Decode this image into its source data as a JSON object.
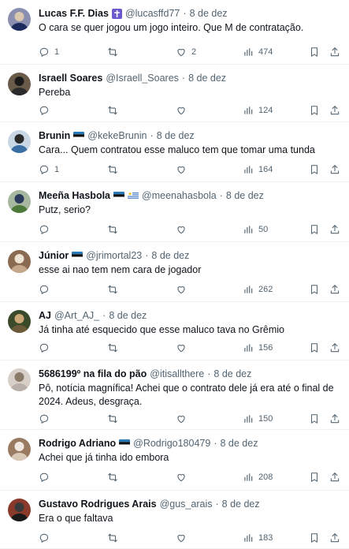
{
  "tweets": [
    {
      "name": "Lucas F.F. Dias",
      "handle": "@lucasffd77",
      "date": "8 de dez",
      "text": "O cara se quer jogou um jogo inteiro. Que M de contratação.",
      "replies": "1",
      "retweets": "",
      "likes": "2",
      "views": "474",
      "badge": "cross-badge-icon",
      "avatar_colors": [
        "#1c2a5e",
        "#8a8fb0",
        "#d9c7b0"
      ]
    },
    {
      "name": "Israell Soares",
      "handle": "@Israell_Soares",
      "date": "8 de dez",
      "text": "Pereba",
      "replies": "",
      "retweets": "",
      "likes": "",
      "views": "124",
      "avatar_colors": [
        "#2b2b2b",
        "#6a5a4a",
        "#1a1a1a"
      ]
    },
    {
      "name": "Brunin",
      "handle": "@kekeBrunin",
      "date": "8 de dez",
      "text": "Cara... Quem contratou esse maluco tem que tomar uma tunda",
      "replies": "1",
      "retweets": "",
      "likes": "",
      "views": "164",
      "flags": [
        "flag-gremio"
      ],
      "avatar_colors": [
        "#3a6ea5",
        "#c9d6e3",
        "#2a2a2a"
      ]
    },
    {
      "name": "Meeña Hasbola",
      "handle": "@meenahasbola",
      "date": "8 de dez",
      "text": "Putz, serio?",
      "replies": "",
      "retweets": "",
      "likes": "",
      "views": "50",
      "flags": [
        "flag-gremio",
        "flag-uruguay"
      ],
      "avatar_colors": [
        "#4d7a3a",
        "#a8b8a0",
        "#2a3a5a"
      ]
    },
    {
      "name": "Júnior",
      "handle": "@jrimortal23",
      "date": "8 de dez",
      "text": "esse ai nao tem nem cara de jogador",
      "replies": "",
      "retweets": "",
      "likes": "",
      "views": "262",
      "flags": [
        "flag-gremio"
      ],
      "avatar_colors": [
        "#c4a88a",
        "#8a6a50",
        "#efe3d4"
      ]
    },
    {
      "name": "AJ",
      "handle": "@Art_AJ_",
      "date": "8 de dez",
      "text": "Já tinha até esquecido que esse maluco tava no Grêmio",
      "replies": "",
      "retweets": "",
      "likes": "",
      "views": "156",
      "avatar_colors": [
        "#6b5a3a",
        "#3a4a2a",
        "#caa878"
      ]
    },
    {
      "name": "5686199º na fila do pão",
      "handle": "@itisallthere",
      "date": "8 de dez",
      "text": "Pô, notícia magnífica! Achei que o contrato dele já era até o final de 2024. Adeus, desgraça.",
      "replies": "",
      "retweets": "",
      "likes": "",
      "views": "150",
      "avatar_colors": [
        "#b8b0a8",
        "#d8d0c8",
        "#8a7a6a"
      ]
    },
    {
      "name": "Rodrigo Adriano",
      "handle": "@Rodrigo180479",
      "date": "8 de dez",
      "text": "Achei que já tinha ido embora",
      "replies": "",
      "retweets": "",
      "likes": "",
      "views": "208",
      "flags": [
        "flag-gremio"
      ],
      "avatar_colors": [
        "#d8c8b8",
        "#9a7a60",
        "#f0e8e0"
      ]
    },
    {
      "name": "Gustavo Rodrigues Arais",
      "handle": "@gus_arais",
      "date": "8 de dez",
      "text": "Era o que faltava",
      "replies": "",
      "retweets": "",
      "likes": "",
      "views": "183",
      "avatar_colors": [
        "#1a1a1a",
        "#8a3a2a",
        "#3a3a3a"
      ]
    }
  ],
  "colors": {
    "text_primary": "#0f1419",
    "text_secondary": "#536471",
    "divider": "#eff3f4",
    "flag_gremio_blue": "#2a7ab8",
    "flag_gremio_black": "#111111",
    "flag_uruguay_blue": "#3a73c0",
    "badge_purple": "#6a5acd"
  }
}
